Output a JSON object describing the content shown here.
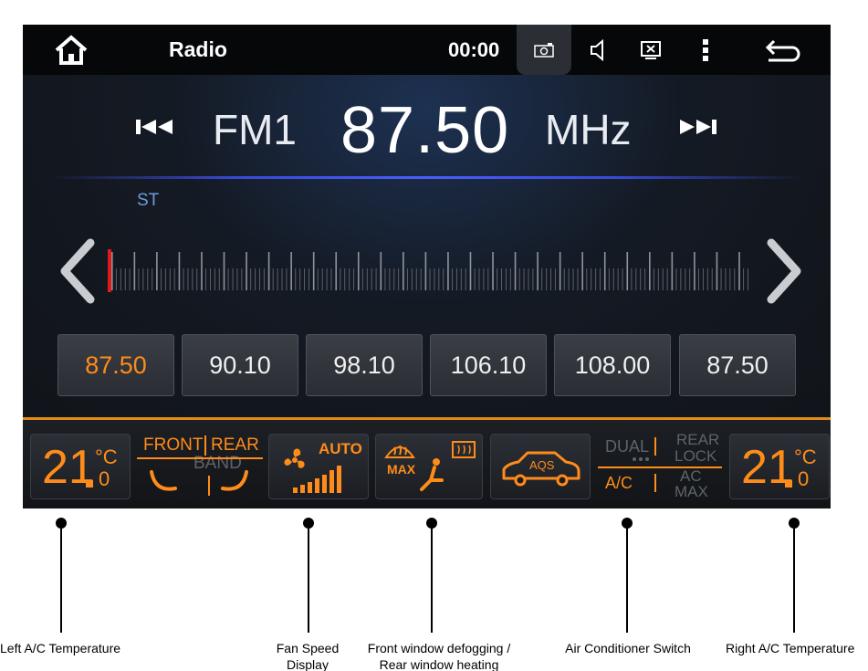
{
  "statusbar": {
    "title": "Radio",
    "clock": "00:00"
  },
  "radio": {
    "band": "FM1",
    "frequency": "87.50",
    "unit": "MHz",
    "stereo_indicator": "ST",
    "tuner_position_fraction": 0.0,
    "presets": [
      "87.50",
      "90.10",
      "98.10",
      "106.10",
      "108.00",
      "87.50"
    ],
    "active_preset_index": 0
  },
  "climate": {
    "left_temp_main": "21",
    "left_temp_unit": "°C",
    "left_temp_decimal": "0",
    "front_label": "FRONT",
    "rear_label": "REAR",
    "band_label": "BAND",
    "fan_auto_label": "AUTO",
    "defog_max_label": "MAX",
    "aqs_label": "AQS",
    "dual_label": "DUAL",
    "ac_label": "A/C",
    "rear_lock_line1": "REAR",
    "rear_lock_line2": "LOCK",
    "ac_max_line1": "AC",
    "ac_max_line2": "MAX",
    "right_temp_main": "21",
    "right_temp_unit": "°C",
    "right_temp_decimal": "0"
  },
  "annotations": {
    "left_temp": "Left A/C Temperature",
    "fan_speed_line1": "Fan Speed",
    "fan_speed_line2": "Display",
    "defog_line1": "Front window defogging /",
    "defog_line2": "Rear window heating",
    "ac_switch": "Air Conditioner Switch",
    "right_temp": "Right A/C Temperature"
  },
  "colors": {
    "accent": "#ff8c1a",
    "tuner_marker": "#e01818",
    "stereo": "#6d9be0",
    "divider": "#4b5cff"
  }
}
